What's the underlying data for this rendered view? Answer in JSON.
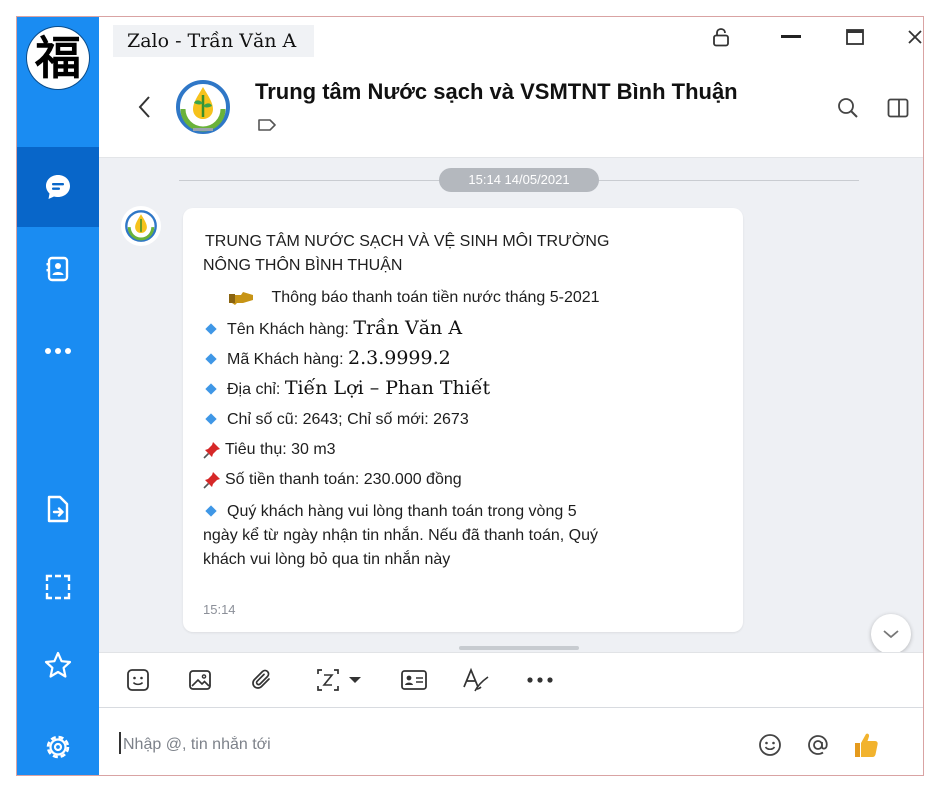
{
  "window": {
    "title": "Zalo - Trần Văn A"
  },
  "sidebar": {
    "avatar_glyph": "福",
    "items": [
      {
        "name": "messages",
        "icon": "chat-bubble-icon",
        "active": true
      },
      {
        "name": "contacts",
        "icon": "contact-card-icon",
        "active": false
      },
      {
        "name": "more",
        "icon": "more-dots-icon",
        "active": false
      },
      {
        "name": "files",
        "icon": "file-transfer-icon",
        "active": false
      },
      {
        "name": "screenshot",
        "icon": "screen-capture-icon",
        "active": false
      },
      {
        "name": "starred",
        "icon": "star-icon",
        "active": false
      },
      {
        "name": "settings",
        "icon": "gear-icon",
        "active": false
      }
    ]
  },
  "conversation": {
    "name": "Trung tâm Nước sạch và VSMTNT Bình Thuận"
  },
  "chat": {
    "date_divider": "15:14 14/05/2021",
    "message": {
      "line1": "TRUNG TÂM NƯỚC SẠCH VÀ VỆ SINH MÔI TRƯỜNG",
      "line2": "NÔNG THÔN BÌNH THUẬN",
      "notice": "Thông báo thanh toán tiền nước tháng 5-2021",
      "customer_name_label": "Tên Khách hàng:",
      "customer_name_value": "Trần Văn A",
      "customer_code_label": "Mã Khách hàng:",
      "customer_code_value": "2.3.9999.2",
      "address_label": "Địa chỉ:",
      "address_value": "Tiến Lợi – Phan Thiết",
      "meter_readings": "Chỉ số cũ: 2643; Chỉ số mới: 2673",
      "consumption": "Tiêu thụ: 30 m3",
      "amount": "Số tiền thanh toán: 230.000 đồng",
      "closing_line1": "Quý khách hàng vui lòng thanh toán trong vòng 5",
      "closing_line2": "ngày kể từ ngày nhận tin nhắn. Nếu đã thanh toán, Quý",
      "closing_line3": "khách vui lòng bỏ qua tin nhắn này",
      "time": "15:14"
    }
  },
  "toolbar": {
    "icons": [
      "sticker-icon",
      "image-icon",
      "attachment-icon",
      "screenshot-dropdown-icon",
      "contact-card-icon",
      "text-format-icon",
      "more-dots-icon"
    ]
  },
  "composer": {
    "placeholder": "Nhập @, tin nhắn tới"
  },
  "colors": {
    "sidebar": "#1a8cf2",
    "sidebar_active": "#0866c9",
    "chat_bg": "#eef0f4",
    "accent_blue": "#3f97e6",
    "like_yellow": "#f2b32e"
  }
}
